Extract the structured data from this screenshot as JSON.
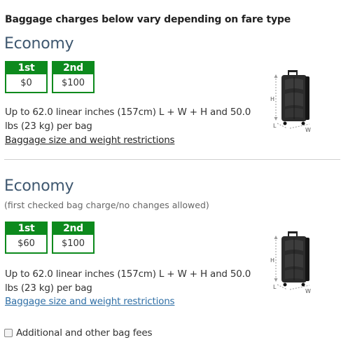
{
  "intro": "Baggage charges below vary depending on fare type",
  "fares": [
    {
      "title": "Economy",
      "subtitle": "",
      "bag1_label": "1st bag",
      "bag1_price": "$0",
      "bag2_label": "2nd bag",
      "bag2_price": "$100",
      "description": "Up to 62.0 linear inches (157cm) L + W + H and 50.0 lbs (23 kg) per bag",
      "link": "Baggage size and weight restrictions",
      "diagram_labels": {
        "h": "H",
        "l": "L",
        "w": "W"
      }
    },
    {
      "title": "Economy",
      "subtitle": "(first checked bag charge/no changes allowed)",
      "bag1_label": "1st bag",
      "bag1_price": "$60",
      "bag2_label": "2nd bag",
      "bag2_price": "$100",
      "description": "Up to 62.0 linear inches (157cm) L + W + H and 50.0 lbs (23 kg) per bag",
      "link": "Baggage size and weight restrictions",
      "diagram_labels": {
        "h": "H",
        "l": "L",
        "w": "W"
      }
    }
  ],
  "additional_fees": "Additional and other bag fees",
  "colors": {
    "accent_green": "#0d8a1d",
    "title_blue": "#3f5870",
    "link_blue": "#2f6fa6"
  }
}
